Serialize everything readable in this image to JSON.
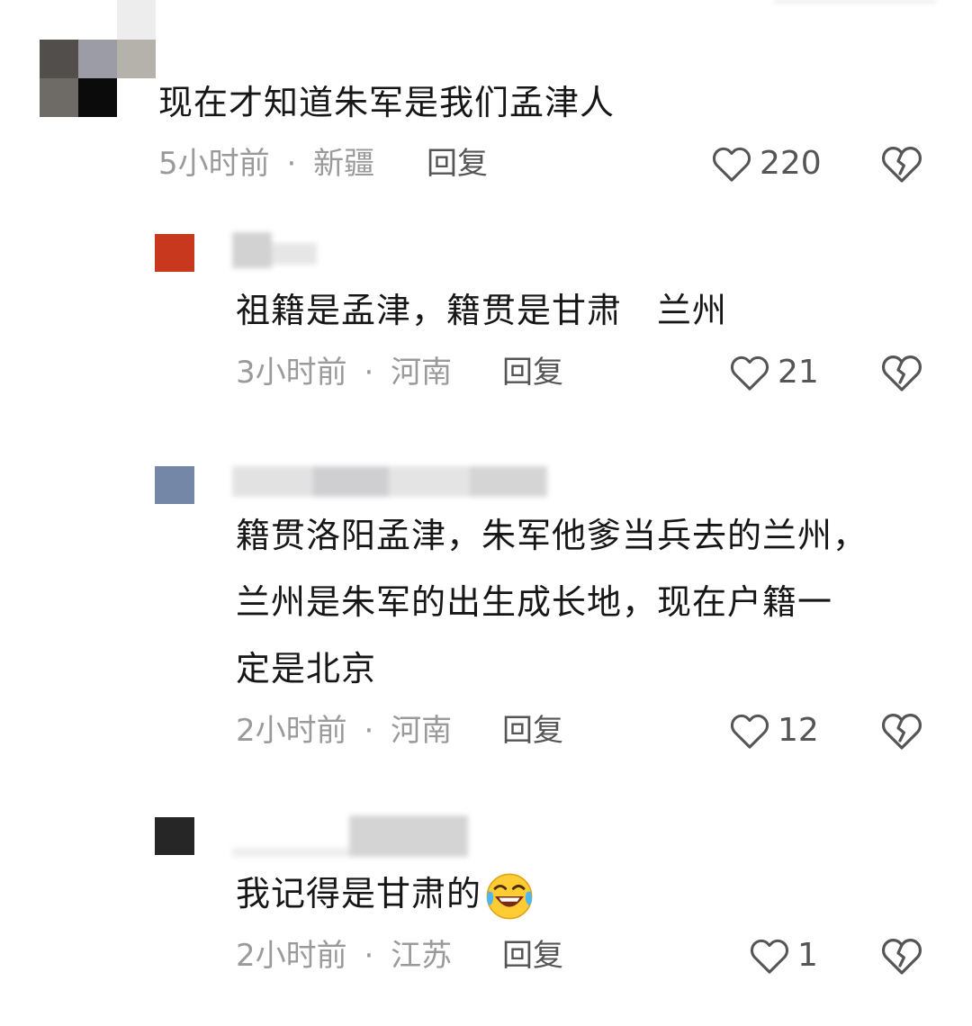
{
  "comments": [
    {
      "text_lines": [
        "现在才知道朱军是我们孟津人"
      ],
      "time": "5小时前",
      "location": "新疆",
      "reply_label": "回复",
      "likes": "220"
    },
    {
      "text_lines": [
        "祖籍是孟津，籍贯是甘肃　兰州"
      ],
      "time": "3小时前",
      "location": "河南",
      "reply_label": "回复",
      "likes": "21"
    },
    {
      "text_lines": [
        "籍贯洛阳孟津，朱军他爹当兵去的兰州，",
        "兰州是朱军的出生成长地，现在户籍一",
        "定是北京"
      ],
      "time": "2小时前",
      "location": "河南",
      "reply_label": "回复",
      "likes": "12"
    },
    {
      "text_lines": [
        "我记得是甘肃的"
      ],
      "emoji": "laughing-crying-emoji",
      "time": "2小时前",
      "location": "江苏",
      "reply_label": "回复",
      "likes": "1"
    }
  ],
  "separator": "·",
  "icons": {
    "like": "heart-outline-icon",
    "dislike": "broken-heart-icon"
  },
  "colors": {
    "text": "#161616",
    "meta": "#9a9a9a",
    "action": "#555555",
    "avatar2": "#c8381e",
    "avatar3": "#7587a6",
    "avatar4": "#262626"
  }
}
